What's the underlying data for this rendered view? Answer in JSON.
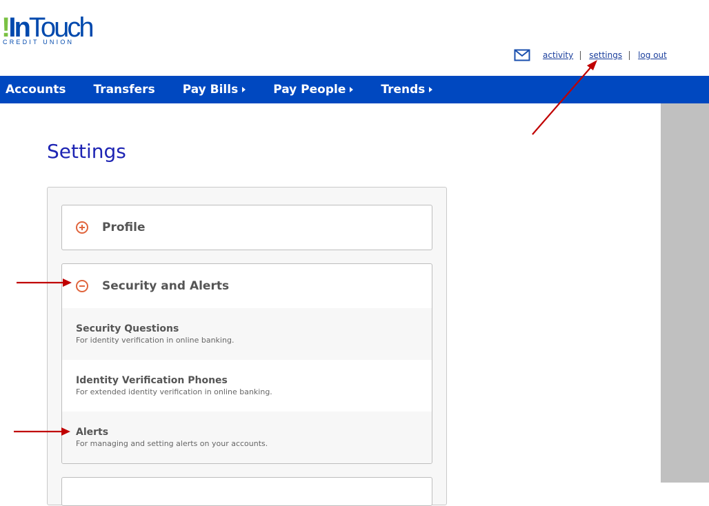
{
  "brand": {
    "logo_bang": "!",
    "logo_in": "In",
    "logo_touch": "Touch",
    "logo_sub": "CREDIT UNION",
    "primary_color": "#0048c0",
    "accent_color": "#e0643c"
  },
  "top_links": {
    "mail_icon": "mail-icon",
    "activity": "activity",
    "settings": "settings",
    "logout": "log out"
  },
  "nav": {
    "items": [
      {
        "label": "Accounts",
        "has_caret": false
      },
      {
        "label": "Transfers",
        "has_caret": false
      },
      {
        "label": "Pay Bills",
        "has_caret": true
      },
      {
        "label": "Pay People",
        "has_caret": true
      },
      {
        "label": "Trends",
        "has_caret": true
      }
    ]
  },
  "page": {
    "title": "Settings"
  },
  "sections": [
    {
      "title": "Profile",
      "icon": "expand-plus-icon",
      "expanded": false
    },
    {
      "title": "Security and Alerts",
      "icon": "collapse-minus-icon",
      "expanded": true,
      "items": [
        {
          "title": "Security Questions",
          "description": "For identity verification in online banking."
        },
        {
          "title": "Identity Verification Phones",
          "description": "For extended identity verification in online banking."
        },
        {
          "title": "Alerts",
          "description": "For managing and setting alerts on your accounts."
        }
      ]
    }
  ],
  "annotation_color": "#c00000"
}
